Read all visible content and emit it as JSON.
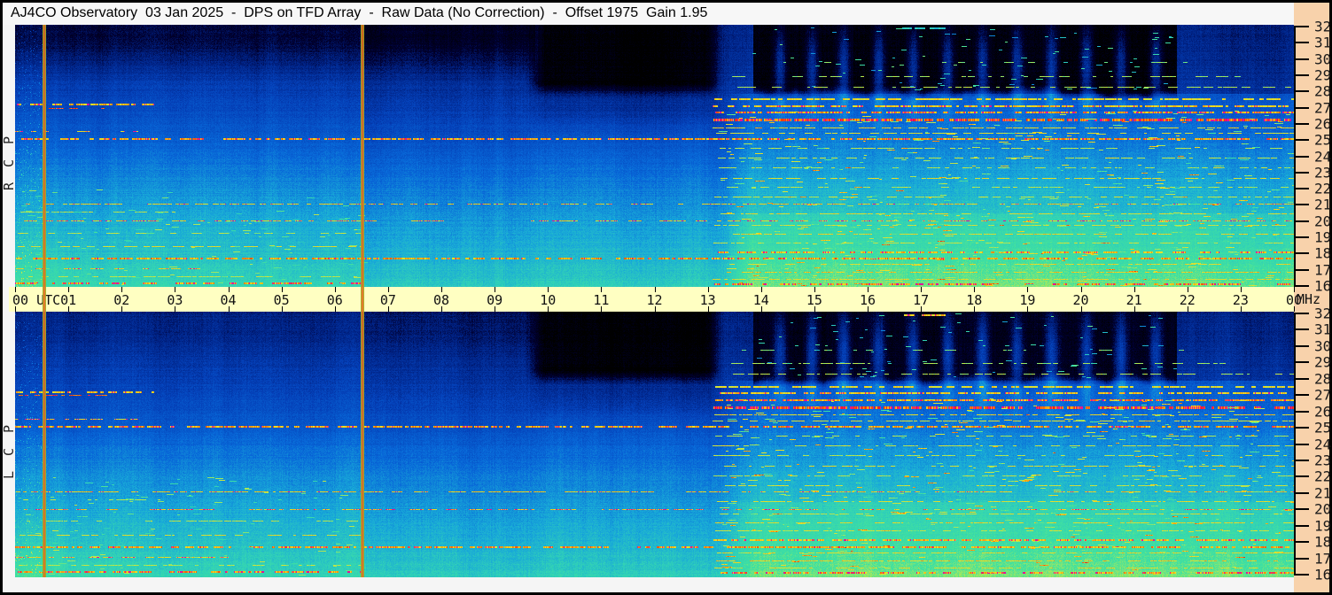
{
  "header": {
    "title": "AJ4CO Observatory  03 Jan 2025  -  DPS on TFD Array  -  Raw Data (No Correction)  -  Offset 1975  Gain 1.95"
  },
  "colors": {
    "border": "#000000",
    "window_bg": "#F5F5F5",
    "ruler_bg": "#F8D2AB",
    "time_axis_bg": "#FFFFC2",
    "tick": "#000000",
    "label": "#111111",
    "marker_edge": "#A8A820",
    "marker_core": "#E07020"
  },
  "chart_data": {
    "type": "heatmap",
    "description": "Dual-polarization 24-hour radio dynamic spectrum (spectrograph), 16-32 MHz vs 00-24 UTC, jet color scale",
    "x": {
      "min": 0,
      "max": 24,
      "unit": "UTC",
      "tick_labels": [
        "00 UTC",
        "01",
        "02",
        "03",
        "04",
        "05",
        "06",
        "07",
        "08",
        "09",
        "10",
        "11",
        "12",
        "13",
        "14",
        "15",
        "16",
        "17",
        "18",
        "19",
        "20",
        "21",
        "22",
        "23",
        "00"
      ]
    },
    "y": {
      "min": 16,
      "max": 32,
      "unit": "MHz",
      "ticks": [
        32,
        31,
        30,
        29,
        28,
        27,
        26,
        25,
        24,
        23,
        22,
        21,
        20,
        19,
        18,
        17,
        16
      ]
    },
    "panels": [
      {
        "id": "rcp",
        "label": "RCP",
        "nightTopDark": 0.11,
        "blackLevel": 0.04
      },
      {
        "id": "lcp",
        "label": "LCP",
        "nightTopDark": 0.03,
        "blackLevel": 0.075
      }
    ],
    "palette": [
      [
        0.0,
        0,
        0,
        0
      ],
      [
        0.1,
        0,
        0,
        48
      ],
      [
        0.18,
        0,
        32,
        128
      ],
      [
        0.28,
        4,
        64,
        184
      ],
      [
        0.4,
        8,
        104,
        216
      ],
      [
        0.52,
        24,
        168,
        216
      ],
      [
        0.62,
        48,
        208,
        184
      ],
      [
        0.7,
        64,
        224,
        160
      ],
      [
        0.78,
        160,
        232,
        96
      ],
      [
        0.86,
        240,
        224,
        32
      ],
      [
        0.92,
        248,
        144,
        16
      ],
      [
        0.965,
        240,
        32,
        16
      ],
      [
        1.0,
        224,
        16,
        176
      ]
    ],
    "background_profile": [
      [
        32,
        0.215
      ],
      [
        30,
        0.235
      ],
      [
        28,
        0.27
      ],
      [
        26,
        0.33
      ],
      [
        24,
        0.4
      ],
      [
        22,
        0.47
      ],
      [
        20,
        0.525
      ],
      [
        18,
        0.575
      ],
      [
        16,
        0.635
      ]
    ],
    "events": {
      "day_start": 13.2,
      "dark_patch": {
        "t0": 9.75,
        "t1": 13.2,
        "f_min": 28.2
      },
      "black_top": {
        "t0": 13.85,
        "t1": 21.8,
        "f_min": 27.9
      },
      "morning_dim": {
        "t0": 6.5,
        "t1": 9.75,
        "dv": -0.018
      },
      "night_top_dark_fmin": 28.5
    },
    "markers": [
      {
        "t": 0.53
      },
      {
        "t": 6.5
      }
    ],
    "plumes": [
      14.35,
      14.95,
      15.55,
      16.2,
      16.85,
      17.5,
      18.15,
      18.8,
      19.45,
      20.1,
      20.75,
      21.4
    ],
    "column_steps": [
      {
        "t": 6.5,
        "dv": -0.018
      },
      {
        "t": 9.75,
        "dv": -0.008
      },
      {
        "t": 13.2,
        "dv": 0.0
      },
      {
        "t": 22.8,
        "dv": -0.012
      }
    ],
    "interference_lines": [
      {
        "f": 27.2,
        "t0": 0,
        "t1": 2.6,
        "v": 0.88,
        "d": 0.5,
        "th": 2,
        "mag": 0.12
      },
      {
        "f": 27.0,
        "t0": 0,
        "t1": 1.8,
        "v": 0.95,
        "d": 0.35,
        "th": 1
      },
      {
        "f": 25.55,
        "t0": 0,
        "t1": 2.3,
        "v": 0.86,
        "d": 0.4,
        "th": 1,
        "mag": 0.25
      },
      {
        "f": 16.15,
        "t0": 0,
        "t1": 6.5,
        "v": 0.9,
        "d": 0.45,
        "th": 2,
        "mag": 0.3
      },
      {
        "f": 18.45,
        "t0": 0,
        "t1": 6.5,
        "v": 0.84,
        "d": 0.35,
        "th": 1
      },
      {
        "f": 19.3,
        "t0": 0,
        "t1": 6.5,
        "v": 0.8,
        "d": 0.25,
        "th": 1
      },
      {
        "f": 17.1,
        "t0": 0,
        "t1": 4,
        "v": 0.86,
        "d": 0.3,
        "th": 1,
        "mag": 0.2
      },
      {
        "f": 16.6,
        "t0": 0,
        "t1": 6.5,
        "v": 0.8,
        "d": 0.3,
        "th": 1
      },
      {
        "f": 20.6,
        "t0": 0,
        "t1": 3,
        "v": 0.8,
        "d": 0.2,
        "th": 1
      },
      {
        "f": 25.08,
        "t0": 0,
        "t1": 24,
        "v": 0.9,
        "d": 0.8,
        "th": 2,
        "mag": 0.12
      },
      {
        "f": 20.02,
        "t0": 0,
        "t1": 24,
        "v": 0.87,
        "d": 0.45,
        "th": 1,
        "mag": 0.3
      },
      {
        "f": 17.68,
        "t0": 0,
        "t1": 24,
        "v": 0.9,
        "d": 0.7,
        "th": 2,
        "mag": 0.08
      },
      {
        "f": 21.08,
        "t0": 0,
        "t1": 24,
        "v": 0.87,
        "d": 0.5,
        "th": 1,
        "mag": 0.1
      },
      {
        "f": 26.25,
        "t0": 13.1,
        "t1": 24,
        "v": 0.93,
        "d": 0.9,
        "th": 3,
        "mag": 0.3
      },
      {
        "f": 26.7,
        "t0": 13.1,
        "t1": 24,
        "v": 0.9,
        "d": 0.85,
        "th": 2,
        "mag": 0.2
      },
      {
        "f": 27.1,
        "t0": 13.1,
        "t1": 24,
        "v": 0.87,
        "d": 0.7,
        "th": 2,
        "mag": 0.1
      },
      {
        "f": 27.5,
        "t0": 13.1,
        "t1": 24,
        "v": 0.85,
        "d": 0.55,
        "th": 2
      },
      {
        "f": 25.8,
        "t0": 13.1,
        "t1": 24,
        "v": 0.86,
        "d": 0.6,
        "th": 1
      },
      {
        "f": 25.45,
        "t0": 13.1,
        "t1": 24,
        "v": 0.84,
        "d": 0.5,
        "th": 1
      },
      {
        "f": 28.3,
        "t0": 13.3,
        "t1": 24,
        "v": 0.8,
        "d": 0.3,
        "th": 1
      },
      {
        "f": 28.95,
        "t0": 13.3,
        "t1": 23,
        "v": 0.78,
        "d": 0.22,
        "th": 1
      },
      {
        "f": 29.8,
        "t0": 13.5,
        "t1": 22,
        "v": 0.75,
        "d": 0.12,
        "th": 1
      },
      {
        "f": 24.5,
        "t0": 13.1,
        "t1": 24,
        "v": 0.8,
        "d": 0.3,
        "th": 1
      },
      {
        "f": 23.9,
        "t0": 13.1,
        "t1": 24,
        "v": 0.82,
        "d": 0.35,
        "th": 1
      },
      {
        "f": 23.3,
        "t0": 13.1,
        "t1": 24,
        "v": 0.8,
        "d": 0.3,
        "th": 1
      },
      {
        "f": 22.65,
        "t0": 13.1,
        "t1": 24,
        "v": 0.84,
        "d": 0.4,
        "th": 1
      },
      {
        "f": 22.1,
        "t0": 13.1,
        "t1": 24,
        "v": 0.8,
        "d": 0.3,
        "th": 1
      },
      {
        "f": 21.5,
        "t0": 13.1,
        "t1": 24,
        "v": 0.82,
        "d": 0.35,
        "th": 1
      },
      {
        "f": 20.5,
        "t0": 13.1,
        "t1": 24,
        "v": 0.84,
        "d": 0.45,
        "th": 1
      },
      {
        "f": 19.75,
        "t0": 13.1,
        "t1": 24,
        "v": 0.82,
        "d": 0.4,
        "th": 1
      },
      {
        "f": 19.2,
        "t0": 13.1,
        "t1": 24,
        "v": 0.85,
        "d": 0.45,
        "th": 1
      },
      {
        "f": 18.7,
        "t0": 13.1,
        "t1": 24,
        "v": 0.82,
        "d": 0.35,
        "th": 1
      },
      {
        "f": 18.1,
        "t0": 13.1,
        "t1": 24,
        "v": 0.88,
        "d": 0.55,
        "th": 2,
        "mag": 0.15
      },
      {
        "f": 17.35,
        "t0": 13.1,
        "t1": 24,
        "v": 0.85,
        "d": 0.45,
        "th": 1
      },
      {
        "f": 16.85,
        "t0": 13.1,
        "t1": 24,
        "v": 0.87,
        "d": 0.5,
        "th": 1
      },
      {
        "f": 16.45,
        "t0": 13.1,
        "t1": 24,
        "v": 0.85,
        "d": 0.45,
        "th": 1
      },
      {
        "f": 16.1,
        "t0": 13.1,
        "t1": 24,
        "v": 0.9,
        "d": 0.55,
        "th": 2,
        "mag": 0.3
      },
      {
        "f": 31.9,
        "t0": 16.65,
        "t1": 17.45,
        "v": 0.6,
        "d": 0.95,
        "th": 2,
        "panel": "rcp"
      },
      {
        "f": 31.9,
        "t0": 16.65,
        "t1": 17.45,
        "v": 0.88,
        "d": 0.95,
        "th": 2,
        "mag": 0.1,
        "panel": "lcp"
      }
    ],
    "seed": 1337
  }
}
